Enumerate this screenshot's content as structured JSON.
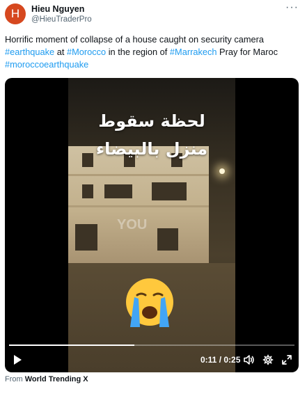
{
  "author": {
    "avatar_letter": "H",
    "name": "Hieu Nguyen",
    "handle": "@HieuTraderPro",
    "avatar_color": "#d6481f"
  },
  "menu": {
    "more_label": "···"
  },
  "tweet": {
    "text_1": "Horrific moment of collapse of a house caught on security camera",
    "tag_earthquake": "#earthquake",
    "text_at": " at ",
    "tag_morocco": "#Morocco",
    "text_region": " in the region of ",
    "tag_marrakech": "#Marrakech",
    "text_pray": " Pray for Maroc",
    "tag_moroccoearthquake": "#moroccoearthquake"
  },
  "video": {
    "overlay_line_1": "لحظة سقوط",
    "overlay_line_2": "منزل بالبيضاء",
    "watermark": "YOU",
    "time_current": "0:11",
    "time_separator": " / ",
    "time_total": "0:25",
    "progress_fraction": 0.44,
    "emoji": "crying-face-emoji"
  },
  "footer": {
    "from_label": "From",
    "source": "World Trending X"
  },
  "colors": {
    "link": "#1d9bf0",
    "secondary_text": "#536471",
    "primary_text": "#0f1419"
  }
}
